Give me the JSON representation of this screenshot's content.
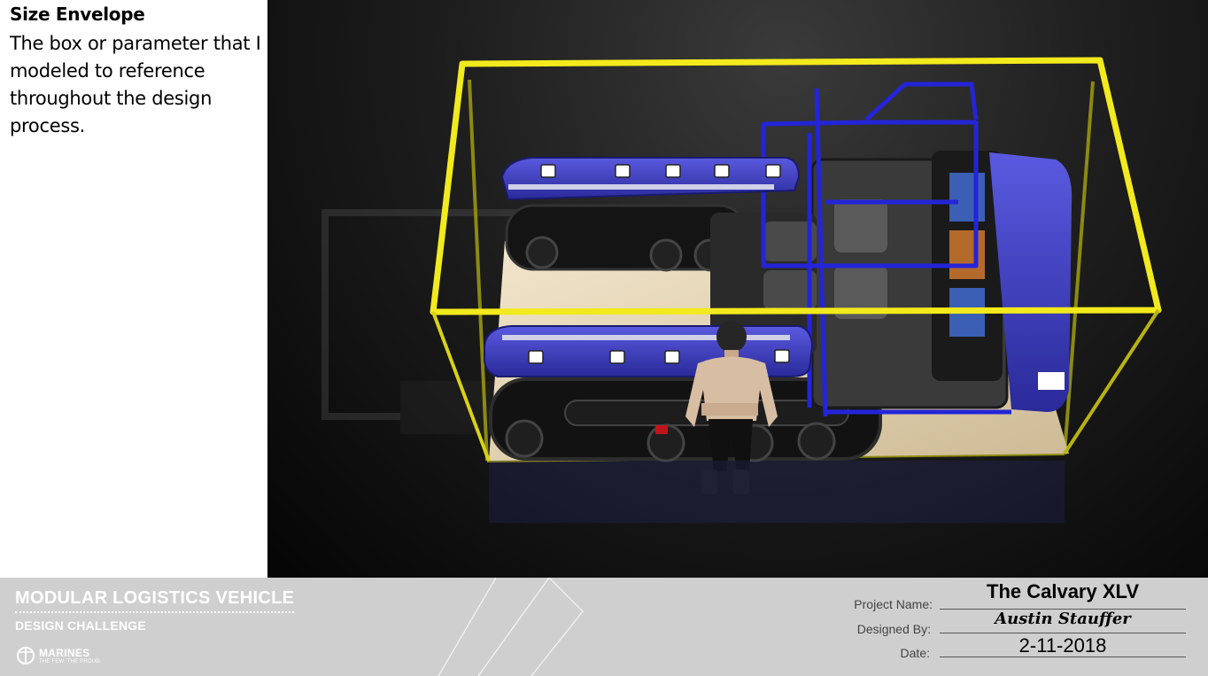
{
  "slide": {
    "heading": "Size Envelope",
    "description": "The box or parameter that I modeled to reference throughout the design process."
  },
  "footer": {
    "brand_title": "MODULAR LOGISTICS VEHICLE",
    "brand_subtitle": "DESIGN CHALLENGE",
    "marines_logo_text": "MARINES",
    "marines_tagline": "THE FEW. THE PROUD.",
    "project_label": "Project Name:",
    "project_value": "The Calvary XLV",
    "designer_label": "Designed By:",
    "designer_value": "Austin Stauffer",
    "date_label": "Date:",
    "date_value": "2-11-2018"
  },
  "colors": {
    "envelope": "#f2ea1c",
    "vehicle_body": "#3b3bc4",
    "frame": "#2a2ae0",
    "footer_bg": "#cfcfcf"
  }
}
